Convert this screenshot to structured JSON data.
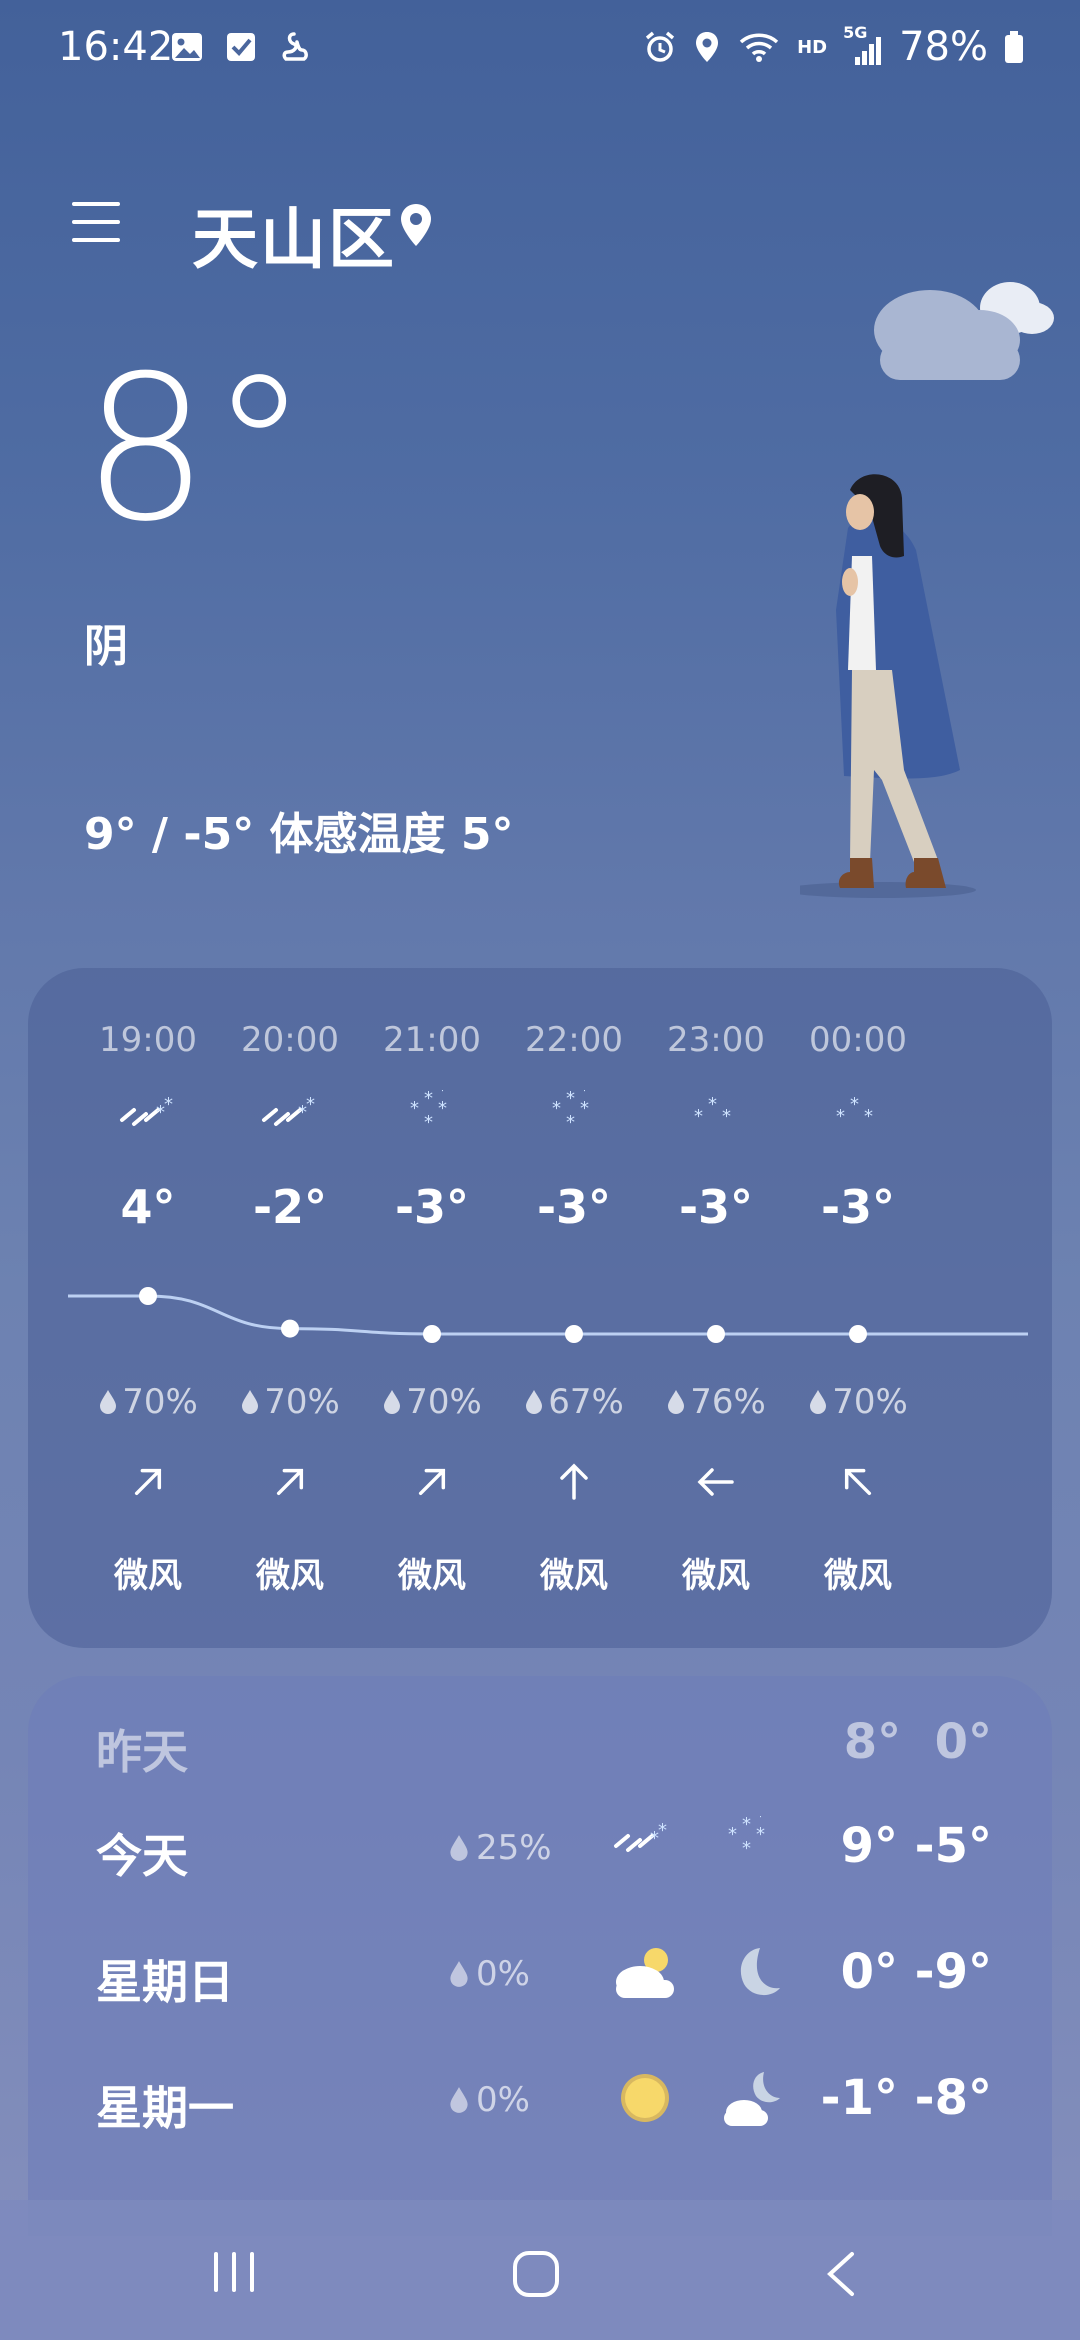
{
  "status_bar": {
    "time": "16:42",
    "network_hd": "HD",
    "network_type": "5G",
    "battery": "78%",
    "left_icons": [
      "gallery-icon",
      "checkbox-icon",
      "swan-icon"
    ],
    "right_icons": [
      "alarm-icon",
      "location-icon",
      "wifi-icon",
      "signal-icon",
      "battery-icon"
    ]
  },
  "header": {
    "location": "天山区"
  },
  "current": {
    "temperature": "8°",
    "condition": "阴",
    "high_low_feels": "9° / -5° 体感温度 5°"
  },
  "hourly": [
    {
      "time": "19:00",
      "icon": "sleet-icon",
      "temp": "4°",
      "precip": "70%",
      "wind_direction": "northeast",
      "wind": "微风"
    },
    {
      "time": "20:00",
      "icon": "sleet-icon",
      "temp": "-2°",
      "precip": "70%",
      "wind_direction": "northeast",
      "wind": "微风"
    },
    {
      "time": "21:00",
      "icon": "snow-icon",
      "temp": "-3°",
      "precip": "70%",
      "wind_direction": "northeast",
      "wind": "微风"
    },
    {
      "time": "22:00",
      "icon": "snow-icon",
      "temp": "-3°",
      "precip": "67%",
      "wind_direction": "north",
      "wind": "微风"
    },
    {
      "time": "23:00",
      "icon": "light-snow-icon",
      "temp": "-3°",
      "precip": "76%",
      "wind_direction": "west",
      "wind": "微风"
    },
    {
      "time": "00:00",
      "icon": "light-snow-icon",
      "temp": "-3°",
      "precip": "70%",
      "wind_direction": "northwest",
      "wind": "微风"
    }
  ],
  "hourly_temps": [
    4,
    -2,
    -3,
    -3,
    -3,
    -3
  ],
  "daily": [
    {
      "day": "昨天",
      "precip": "",
      "temps": "8°  0°",
      "dim": true,
      "day_icon": "",
      "night_icon": ""
    },
    {
      "day": "今天",
      "precip": "25%",
      "temps": "9° -5°",
      "dim": false,
      "day_icon": "sleet-icon",
      "night_icon": "snow-icon"
    },
    {
      "day": "星期日",
      "precip": "0%",
      "temps": "0° -9°",
      "dim": false,
      "day_icon": "partly-cloudy-day-icon",
      "night_icon": "moon-icon"
    },
    {
      "day": "星期一",
      "precip": "0%",
      "temps": "-1° -8°",
      "dim": false,
      "day_icon": "sun-icon",
      "night_icon": "partly-cloudy-night-icon"
    }
  ],
  "colors": {
    "accent_line": "#bcd0f2",
    "snow_blue": "#cfe3ff",
    "sun_yellow": "#f7d86a",
    "moon": "#c9d4e4"
  }
}
